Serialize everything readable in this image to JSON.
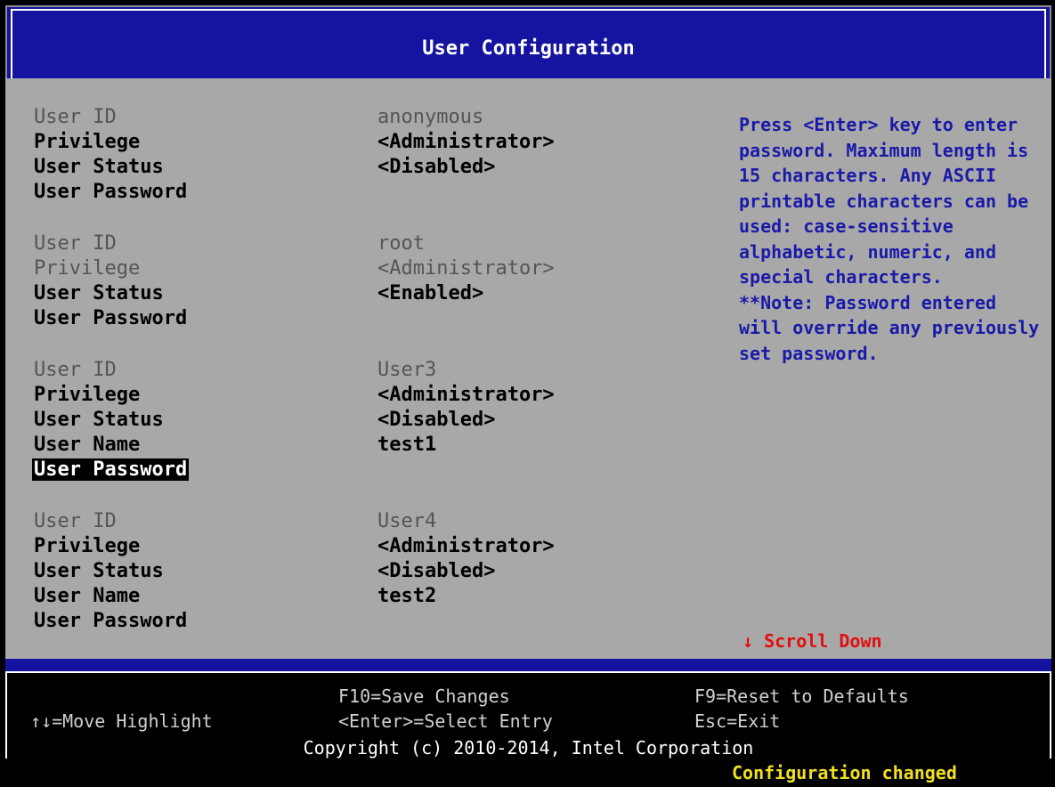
{
  "header": {
    "title": "User Configuration"
  },
  "users": [
    {
      "fields": [
        {
          "label": "User ID",
          "value": "anonymous"
        },
        {
          "label": "Privilege",
          "value": "<Administrator>"
        },
        {
          "label": "User Status",
          "value": "<Disabled>"
        },
        {
          "label": "User Password",
          "value": ""
        }
      ]
    },
    {
      "fields": [
        {
          "label": "User ID",
          "value": "root"
        },
        {
          "label": "Privilege",
          "value": "<Administrator>"
        },
        {
          "label": "User Status",
          "value": "<Enabled>"
        },
        {
          "label": "User Password",
          "value": ""
        }
      ]
    },
    {
      "fields": [
        {
          "label": "User ID",
          "value": "User3"
        },
        {
          "label": "Privilege",
          "value": "<Administrator>"
        },
        {
          "label": "User Status",
          "value": "<Disabled>"
        },
        {
          "label": "User Name",
          "value": "test1"
        },
        {
          "label": "User Password",
          "value": ""
        }
      ]
    },
    {
      "fields": [
        {
          "label": "User ID",
          "value": "User4"
        },
        {
          "label": "Privilege",
          "value": "<Administrator>"
        },
        {
          "label": "User Status",
          "value": "<Disabled>"
        },
        {
          "label": "User Name",
          "value": "test2"
        },
        {
          "label": "User Password",
          "value": ""
        }
      ]
    }
  ],
  "help": {
    "lines": [
      "Press <Enter> key to enter",
      "password. Maximum length is",
      "15 characters. Any ASCII",
      "printable characters can be",
      "used: case-sensitive",
      "alphabetic, numeric, and",
      "special characters.",
      "**Note: Password entered",
      "will override any previously",
      "set password."
    ],
    "scroll": "↓ Scroll Down"
  },
  "footer": {
    "move": "↑↓=Move Highlight",
    "save": "F10=Save Changes",
    "select": "<Enter>=Select Entry",
    "reset": "F9=Reset to Defaults",
    "exit": "Esc=Exit",
    "copyright": "Copyright (c) 2010-2014, Intel Corporation"
  },
  "status": "Configuration changed",
  "colors": {
    "header_bg": "#1414a0",
    "main_bg": "#a8a8a8",
    "help_text": "#1a1aa8",
    "scroll_text": "#e01010",
    "status_text": "#f0e020"
  }
}
